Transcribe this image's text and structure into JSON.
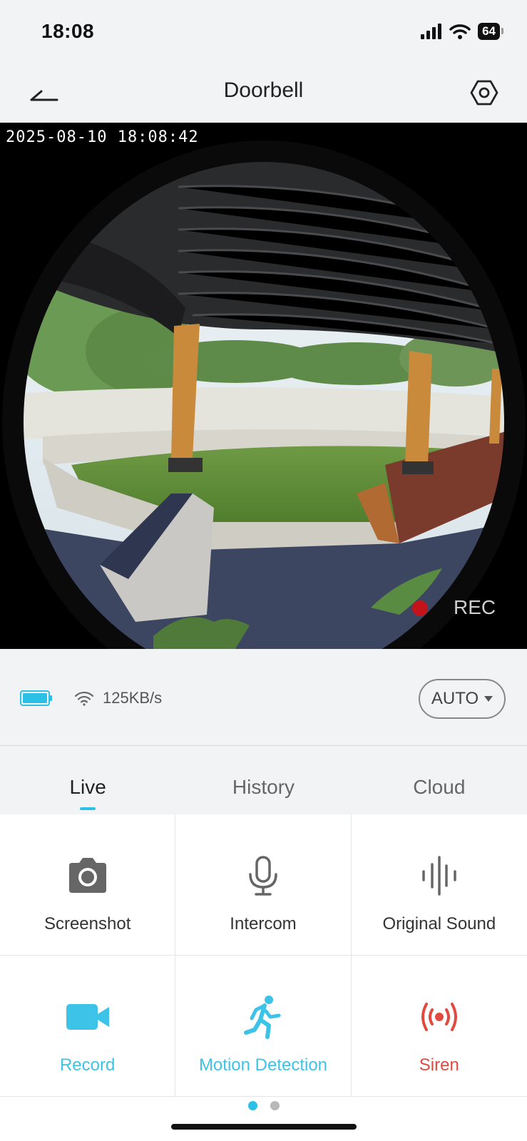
{
  "status_bar": {
    "time": "18:08",
    "battery": "64"
  },
  "nav": {
    "title": "Doorbell",
    "back_icon": "back-arrow-icon",
    "settings_icon": "hexagon-settings-icon"
  },
  "video": {
    "timestamp": "2025-08-10  18:08:42",
    "rec_label": "REC"
  },
  "info": {
    "speed": "125KB/s",
    "quality": "AUTO",
    "battery_color": "#2cc0e6"
  },
  "tabs": [
    {
      "label": "Live",
      "active": true
    },
    {
      "label": "History",
      "active": false
    },
    {
      "label": "Cloud",
      "active": false
    }
  ],
  "controls": [
    {
      "label": "Screenshot",
      "icon": "camera-icon",
      "color": "#666666"
    },
    {
      "label": "Intercom",
      "icon": "microphone-icon",
      "color": "#666666"
    },
    {
      "label": "Original Sound",
      "icon": "sound-wave-icon",
      "color": "#666666"
    },
    {
      "label": "Record",
      "icon": "video-camera-icon",
      "color": "#3ec3e8"
    },
    {
      "label": "Motion Detection",
      "icon": "running-person-icon",
      "color": "#3ec3e8"
    },
    {
      "label": "Siren",
      "icon": "siren-icon",
      "color": "#e04a3f"
    }
  ],
  "pager": {
    "pages": 2,
    "current": 1
  },
  "colors": {
    "accent": "#2cc0e6",
    "danger": "#e04a3f",
    "background": "#f2f3f5"
  }
}
